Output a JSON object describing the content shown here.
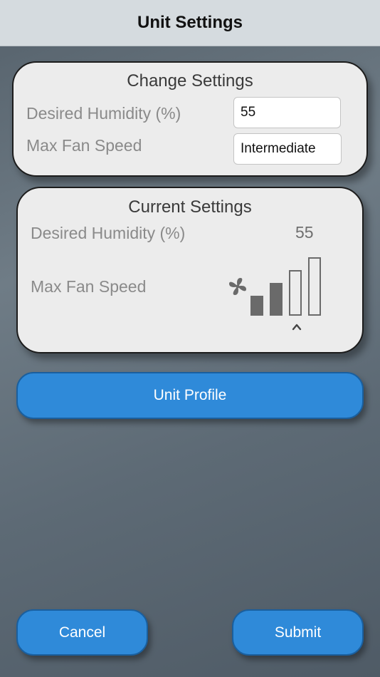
{
  "nav": {
    "title": "Unit Settings"
  },
  "change_settings": {
    "title": "Change Settings",
    "humidity_label": "Desired Humidity (%)",
    "humidity_value": "55",
    "fan_label": "Max Fan Speed",
    "fan_value": "Intermediate"
  },
  "current_settings": {
    "title": "Current Settings",
    "humidity_label": "Desired Humidity (%)",
    "humidity_value": "55",
    "fan_label": "Max Fan Speed",
    "fan_level": 2,
    "fan_level_max": 4
  },
  "buttons": {
    "unit_profile": "Unit Profile",
    "cancel": "Cancel",
    "submit": "Submit"
  },
  "colors": {
    "button_blue": "#2f8ad9",
    "card_bg": "#ececec",
    "nav_bg": "#d5dbdf"
  }
}
